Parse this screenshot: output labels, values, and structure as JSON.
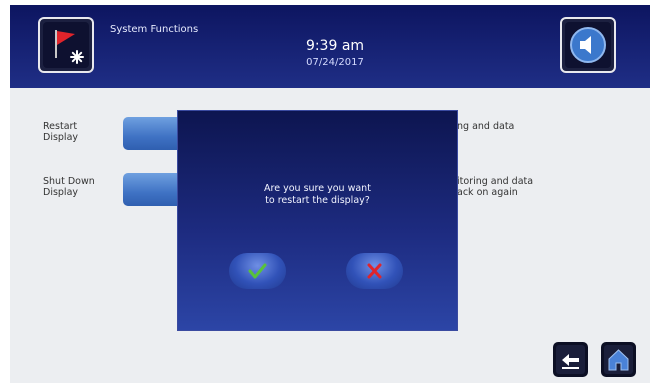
{
  "header": {
    "title": "System Functions",
    "time": "9:39 am",
    "date": "07/24/2017",
    "flag_icon": "alarm-flag-icon",
    "speaker_icon": "speaker-icon"
  },
  "settings": {
    "restart_label": "Restart\nDisplay",
    "shutdown_label": "Shut Down\nDisplay",
    "restart_desc": "ng and data",
    "shutdown_desc": "itoring and data\nack on again"
  },
  "dialog": {
    "message": "Are you sure you want\nto restart the display?",
    "confirm_icon": "checkmark-icon",
    "cancel_icon": "x-icon",
    "confirm_color": "#58c23a",
    "cancel_color": "#e0242b"
  },
  "nav": {
    "back_icon": "back-arrow-icon",
    "home_icon": "home-icon"
  }
}
